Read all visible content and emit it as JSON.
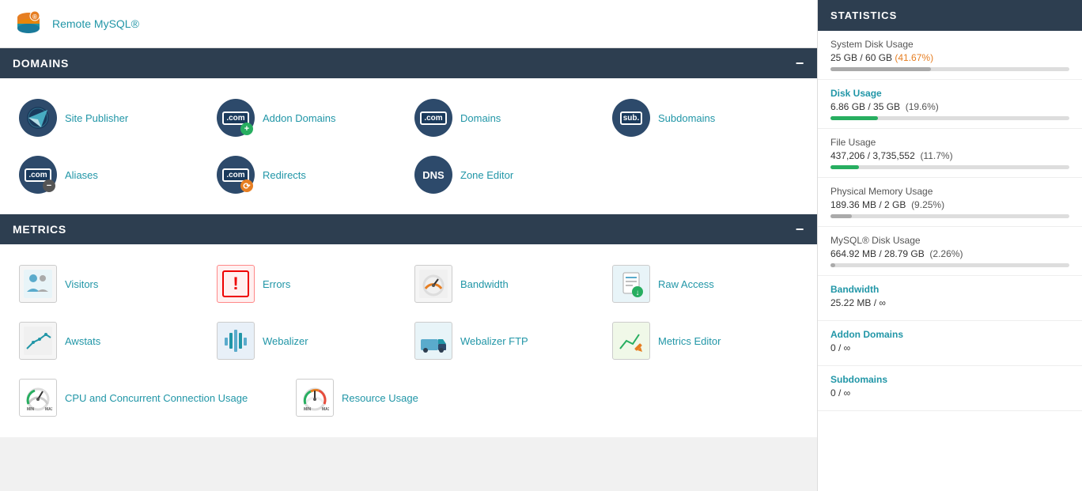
{
  "topbar": {
    "remote_mysql_label": "Remote MySQL®"
  },
  "domains_section": {
    "header": "DOMAINS",
    "items": [
      {
        "id": "site-publisher",
        "label": "Site Publisher",
        "icon_type": "plane"
      },
      {
        "id": "addon-domains",
        "label": "Addon Domains",
        "icon_type": "com-plus"
      },
      {
        "id": "domains",
        "label": "Domains",
        "icon_type": "com"
      },
      {
        "id": "subdomains",
        "label": "Subdomains",
        "icon_type": "sub"
      },
      {
        "id": "aliases",
        "label": "Aliases",
        "icon_type": "com-minus"
      },
      {
        "id": "redirects",
        "label": "Redirects",
        "icon_type": "com-orange"
      },
      {
        "id": "zone-editor",
        "label": "Zone Editor",
        "icon_type": "dns"
      }
    ]
  },
  "metrics_section": {
    "header": "METRICS",
    "items": [
      {
        "id": "visitors",
        "label": "Visitors",
        "icon_type": "visitors"
      },
      {
        "id": "errors",
        "label": "Errors",
        "icon_type": "errors"
      },
      {
        "id": "bandwidth",
        "label": "Bandwidth",
        "icon_type": "bandwidth"
      },
      {
        "id": "raw-access",
        "label": "Raw Access",
        "icon_type": "raw-access"
      },
      {
        "id": "awstats",
        "label": "Awstats",
        "icon_type": "awstats"
      },
      {
        "id": "webalizer",
        "label": "Webalizer",
        "icon_type": "webalizer"
      },
      {
        "id": "webalizer-ftp",
        "label": "Webalizer FTP",
        "icon_type": "webalizer-ftp"
      },
      {
        "id": "metrics-editor",
        "label": "Metrics Editor",
        "icon_type": "metrics-editor"
      },
      {
        "id": "cpu-concurrent",
        "label": "CPU and Concurrent Connection Usage",
        "icon_type": "cpu"
      },
      {
        "id": "resource-usage",
        "label": "Resource Usage",
        "icon_type": "resource"
      }
    ]
  },
  "statistics": {
    "header": "STATISTICS",
    "items": [
      {
        "id": "system-disk",
        "label": "System Disk Usage",
        "value": "25 GB / 60 GB",
        "highlight": "(41.67%)",
        "highlight_color": "orange",
        "progress": 42,
        "bar_color": "gray",
        "is_link": false
      },
      {
        "id": "disk-usage",
        "label": "Disk Usage",
        "value": "6.86 GB / 35 GB",
        "highlight": "(19.6%)",
        "highlight_color": "normal",
        "progress": 20,
        "bar_color": "green",
        "is_link": true
      },
      {
        "id": "file-usage",
        "label": "File Usage",
        "value": "437,206 / 3,735,552",
        "highlight": "(11.7%)",
        "highlight_color": "normal",
        "progress": 12,
        "bar_color": "green",
        "is_link": false
      },
      {
        "id": "physical-memory",
        "label": "Physical Memory Usage",
        "value": "189.36 MB / 2 GB",
        "highlight": "(9.25%)",
        "highlight_color": "normal",
        "progress": 9,
        "bar_color": "gray",
        "is_link": false
      },
      {
        "id": "mysql-disk",
        "label": "MySQL® Disk Usage",
        "value": "664.92 MB / 28.79 GB",
        "highlight": "(2.26%)",
        "highlight_color": "normal",
        "progress": 2,
        "bar_color": "gray",
        "is_link": false
      },
      {
        "id": "bandwidth",
        "label": "Bandwidth",
        "value": "25.22 MB / ∞",
        "highlight": "",
        "progress": 0,
        "bar_color": "none",
        "is_link": true
      },
      {
        "id": "addon-domains",
        "label": "Addon Domains",
        "value": "0 / ∞",
        "highlight": "",
        "progress": 0,
        "bar_color": "none",
        "is_link": true
      },
      {
        "id": "subdomains",
        "label": "Subdomains",
        "value": "0 / ∞",
        "highlight": "",
        "progress": 0,
        "bar_color": "none",
        "is_link": true
      }
    ]
  }
}
